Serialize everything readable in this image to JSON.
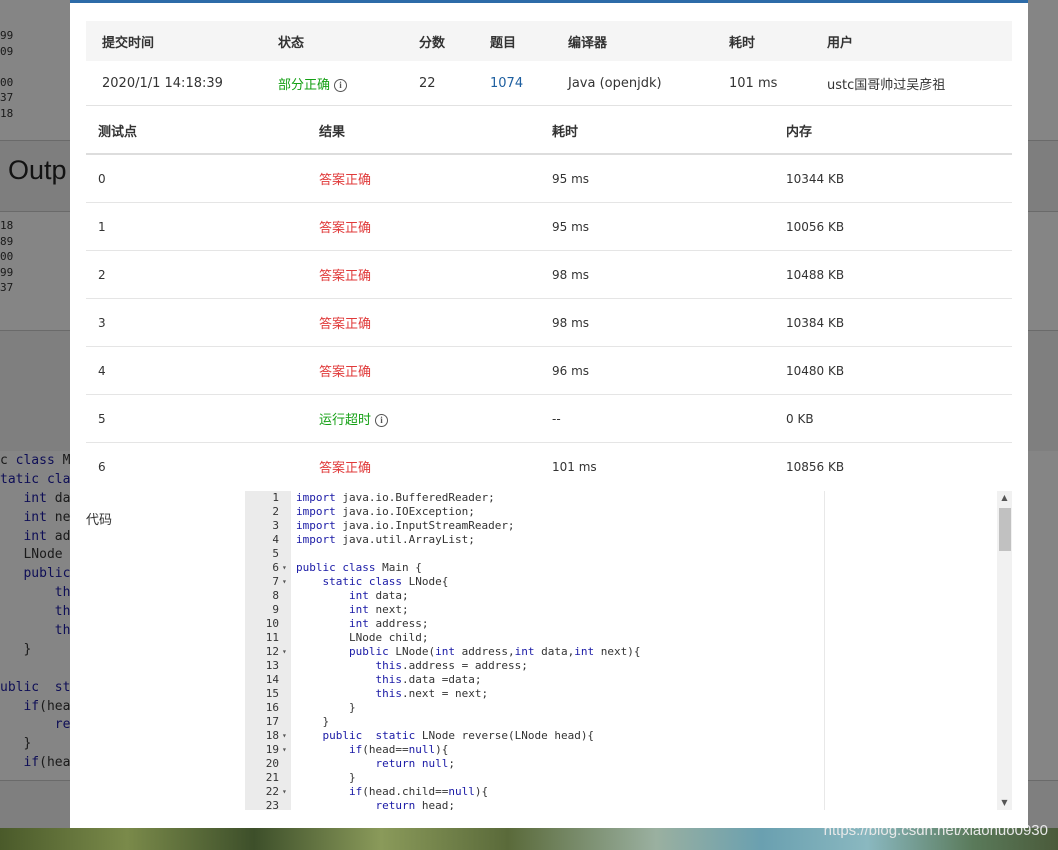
{
  "background_page": {
    "left_numbers_top": [
      "99",
      "09",
      "",
      "00",
      "37",
      "18"
    ],
    "heading_fragment": "Outp",
    "left_numbers_mid": [
      "18",
      "89",
      "00",
      "99",
      "37"
    ],
    "code_fragment": [
      [
        [
          "c ",
          "t"
        ],
        [
          "class",
          "k"
        ],
        [
          " M",
          "t"
        ]
      ],
      [
        [
          "tatic",
          "k"
        ],
        [
          " cla",
          "k"
        ]
      ],
      [
        [
          "   ",
          "t"
        ],
        [
          "int",
          "k"
        ],
        [
          " da",
          "t"
        ]
      ],
      [
        [
          "   ",
          "t"
        ],
        [
          "int",
          "k"
        ],
        [
          " ne",
          "t"
        ]
      ],
      [
        [
          "   ",
          "t"
        ],
        [
          "int",
          "k"
        ],
        [
          " ad",
          "t"
        ]
      ],
      [
        [
          "   LNode",
          "t"
        ]
      ],
      [
        [
          "   ",
          "t"
        ],
        [
          "public",
          "k"
        ]
      ],
      [
        [
          "       ",
          "t"
        ],
        [
          "th",
          "k"
        ]
      ],
      [
        [
          "       ",
          "t"
        ],
        [
          "th",
          "k"
        ]
      ],
      [
        [
          "       ",
          "t"
        ],
        [
          "th",
          "k"
        ]
      ],
      [
        [
          "   }",
          "t"
        ]
      ],
      [
        [
          "",
          "t"
        ]
      ],
      [
        [
          "ublic",
          "k"
        ],
        [
          "  st",
          "k"
        ]
      ],
      [
        [
          "   ",
          "t"
        ],
        [
          "if",
          "k"
        ],
        [
          "(hea",
          "t"
        ]
      ],
      [
        [
          "       ",
          "t"
        ],
        [
          "re",
          "k"
        ]
      ],
      [
        [
          "   }",
          "t"
        ]
      ],
      [
        [
          "   ",
          "t"
        ],
        [
          "if",
          "k"
        ],
        [
          "(hea",
          "t"
        ]
      ]
    ]
  },
  "watermark": "https://blog.csdn.net/xiaohuo0930",
  "submission": {
    "headers": [
      "提交时间",
      "状态",
      "分数",
      "题目",
      "编译器",
      "耗时",
      "用户"
    ],
    "time": "2020/1/1 14:18:39",
    "status": "部分正确",
    "score": "22",
    "problem": "1074",
    "compiler": "Java (openjdk)",
    "elapsed": "101 ms",
    "user": "ustc国哥帅过吴彦祖"
  },
  "cases": {
    "headers": [
      "测试点",
      "结果",
      "耗时",
      "内存"
    ],
    "rows": [
      {
        "id": "0",
        "result": "答案正确",
        "time": "95 ms",
        "memory": "10344 KB",
        "kind": "ok"
      },
      {
        "id": "1",
        "result": "答案正确",
        "time": "95 ms",
        "memory": "10056 KB",
        "kind": "ok"
      },
      {
        "id": "2",
        "result": "答案正确",
        "time": "98 ms",
        "memory": "10488 KB",
        "kind": "ok"
      },
      {
        "id": "3",
        "result": "答案正确",
        "time": "98 ms",
        "memory": "10384 KB",
        "kind": "ok"
      },
      {
        "id": "4",
        "result": "答案正确",
        "time": "96 ms",
        "memory": "10480 KB",
        "kind": "ok"
      },
      {
        "id": "5",
        "result": "运行超时",
        "time": "--",
        "memory": "0 KB",
        "kind": "tle"
      },
      {
        "id": "6",
        "result": "答案正确",
        "time": "101 ms",
        "memory": "10856 KB",
        "kind": "ok"
      }
    ]
  },
  "code_label": "代码",
  "code_lines": [
    {
      "n": "1",
      "fold": false,
      "seg": [
        [
          "import",
          "k"
        ],
        [
          " java.io.BufferedReader;",
          "t"
        ]
      ]
    },
    {
      "n": "2",
      "fold": false,
      "seg": [
        [
          "import",
          "k"
        ],
        [
          " java.io.IOException;",
          "t"
        ]
      ]
    },
    {
      "n": "3",
      "fold": false,
      "seg": [
        [
          "import",
          "k"
        ],
        [
          " java.io.InputStreamReader;",
          "t"
        ]
      ]
    },
    {
      "n": "4",
      "fold": false,
      "seg": [
        [
          "import",
          "k"
        ],
        [
          " java.util.ArrayList;",
          "t"
        ]
      ]
    },
    {
      "n": "5",
      "fold": false,
      "seg": []
    },
    {
      "n": "6",
      "fold": true,
      "seg": [
        [
          "public",
          "k"
        ],
        [
          " ",
          "t"
        ],
        [
          "class",
          "k"
        ],
        [
          " Main {",
          "t"
        ]
      ]
    },
    {
      "n": "7",
      "fold": true,
      "seg": [
        [
          "    ",
          "t"
        ],
        [
          "static",
          "k"
        ],
        [
          " ",
          "t"
        ],
        [
          "class",
          "k"
        ],
        [
          " LNode{",
          "t"
        ]
      ]
    },
    {
      "n": "8",
      "fold": false,
      "seg": [
        [
          "        ",
          "t"
        ],
        [
          "int",
          "k"
        ],
        [
          " data;",
          "t"
        ]
      ]
    },
    {
      "n": "9",
      "fold": false,
      "seg": [
        [
          "        ",
          "t"
        ],
        [
          "int",
          "k"
        ],
        [
          " next;",
          "t"
        ]
      ]
    },
    {
      "n": "10",
      "fold": false,
      "seg": [
        [
          "        ",
          "t"
        ],
        [
          "int",
          "k"
        ],
        [
          " address;",
          "t"
        ]
      ]
    },
    {
      "n": "11",
      "fold": false,
      "seg": [
        [
          "        LNode child;",
          "t"
        ]
      ]
    },
    {
      "n": "12",
      "fold": true,
      "seg": [
        [
          "        ",
          "t"
        ],
        [
          "public",
          "k"
        ],
        [
          " LNode(",
          "t"
        ],
        [
          "int",
          "k"
        ],
        [
          " address,",
          "t"
        ],
        [
          "int",
          "k"
        ],
        [
          " data,",
          "t"
        ],
        [
          "int",
          "k"
        ],
        [
          " next){",
          "t"
        ]
      ]
    },
    {
      "n": "13",
      "fold": false,
      "seg": [
        [
          "            ",
          "t"
        ],
        [
          "this",
          "k"
        ],
        [
          ".address = address;",
          "t"
        ]
      ]
    },
    {
      "n": "14",
      "fold": false,
      "seg": [
        [
          "            ",
          "t"
        ],
        [
          "this",
          "k"
        ],
        [
          ".data =data;",
          "t"
        ]
      ]
    },
    {
      "n": "15",
      "fold": false,
      "seg": [
        [
          "            ",
          "t"
        ],
        [
          "this",
          "k"
        ],
        [
          ".next = next;",
          "t"
        ]
      ]
    },
    {
      "n": "16",
      "fold": false,
      "seg": [
        [
          "        }",
          "t"
        ]
      ]
    },
    {
      "n": "17",
      "fold": false,
      "seg": [
        [
          "    }",
          "t"
        ]
      ]
    },
    {
      "n": "18",
      "fold": true,
      "seg": [
        [
          "    ",
          "t"
        ],
        [
          "public",
          "k"
        ],
        [
          "  ",
          "t"
        ],
        [
          "static",
          "k"
        ],
        [
          " LNode reverse(LNode head){",
          "t"
        ]
      ]
    },
    {
      "n": "19",
      "fold": true,
      "seg": [
        [
          "        ",
          "t"
        ],
        [
          "if",
          "k"
        ],
        [
          "(head==",
          "t"
        ],
        [
          "null",
          "k"
        ],
        [
          "){",
          "t"
        ]
      ]
    },
    {
      "n": "20",
      "fold": false,
      "seg": [
        [
          "            ",
          "t"
        ],
        [
          "return",
          "k"
        ],
        [
          " ",
          "t"
        ],
        [
          "null",
          "k"
        ],
        [
          ";",
          "t"
        ]
      ]
    },
    {
      "n": "21",
      "fold": false,
      "seg": [
        [
          "        }",
          "t"
        ]
      ]
    },
    {
      "n": "22",
      "fold": true,
      "seg": [
        [
          "        ",
          "t"
        ],
        [
          "if",
          "k"
        ],
        [
          "(head.child==",
          "t"
        ],
        [
          "null",
          "k"
        ],
        [
          "){",
          "t"
        ]
      ]
    },
    {
      "n": "23",
      "fold": false,
      "seg": [
        [
          "            ",
          "t"
        ],
        [
          "return",
          "k"
        ],
        [
          " head;",
          "t"
        ]
      ]
    }
  ],
  "icons": {
    "info": "info-circle-icon",
    "fold": "fold-arrow-icon",
    "scroll_up": "scroll-up-arrow-icon",
    "scroll_down": "scroll-down-arrow-icon"
  },
  "colors": {
    "accent": "#2d6ba8",
    "accepted": "#e03a3a",
    "partial": "#15a015",
    "keyword": "#1a1aa6",
    "link": "#1e5fa0"
  }
}
